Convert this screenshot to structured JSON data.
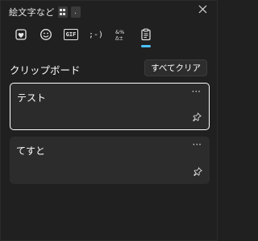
{
  "window": {
    "title": "絵文字など",
    "shortcut_key": ".",
    "icons": {
      "win_key": "windows-logo-icon",
      "close": "close-icon"
    }
  },
  "tabs": [
    {
      "name": "heart-emoji-icon",
      "label": ""
    },
    {
      "name": "emoji-smile-icon",
      "label": ""
    },
    {
      "name": "gif-icon",
      "label": "GIF"
    },
    {
      "name": "kaomoji-icon",
      "label": ";-)"
    },
    {
      "name": "symbols-icon",
      "label": ""
    },
    {
      "name": "clipboard-icon",
      "label": ""
    }
  ],
  "active_tab": "clipboard",
  "clipboard": {
    "heading": "クリップボード",
    "clear_all_label": "すべてクリア",
    "items": [
      {
        "text": "テスト",
        "more": "···",
        "selected": true
      },
      {
        "text": "てすと",
        "more": "···",
        "selected": false
      }
    ]
  },
  "colors": {
    "background": "#202020",
    "card": "#2c2c2c",
    "accent": "#4cc2ff",
    "text": "#ffffff"
  }
}
